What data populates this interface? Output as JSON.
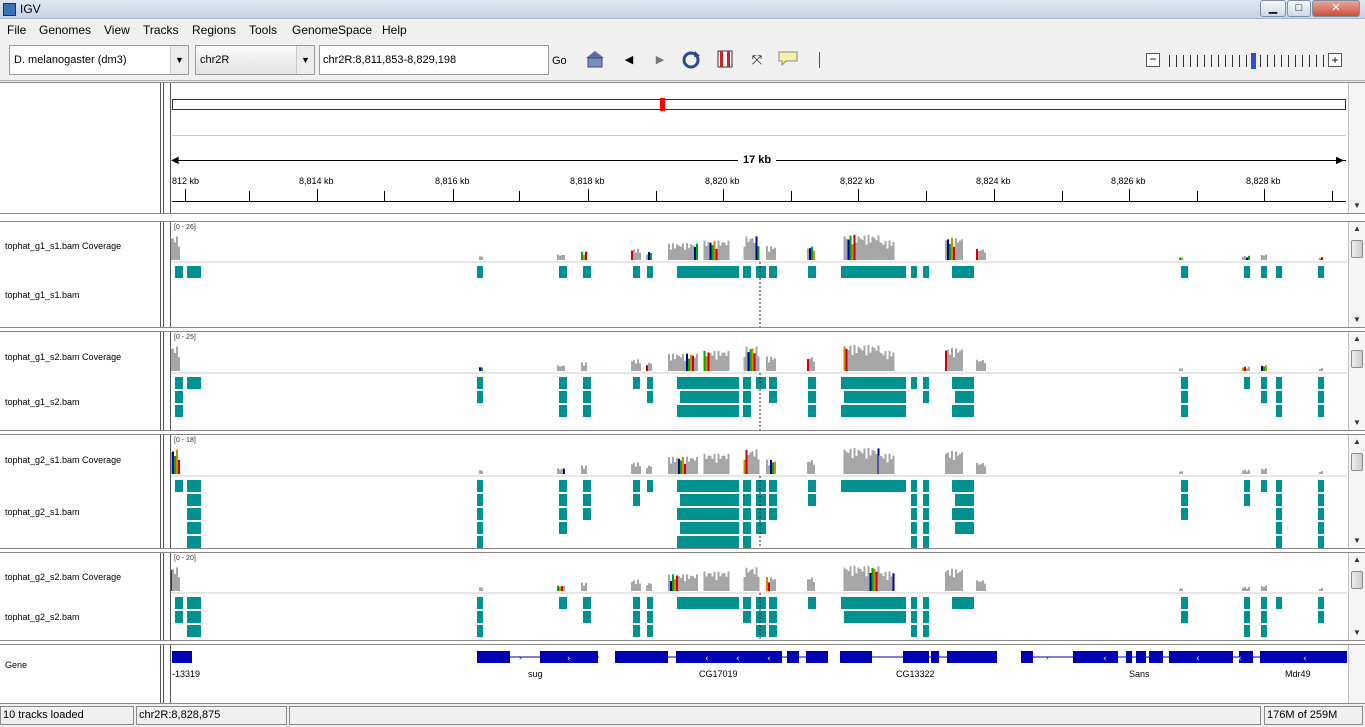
{
  "window": {
    "title": "IGV",
    "minimize": "▁",
    "maximize": "□",
    "close": "✕"
  },
  "menu": [
    "File",
    "Genomes",
    "View",
    "Tracks",
    "Regions",
    "Tools",
    "GenomeSpace",
    "Help"
  ],
  "toolbar": {
    "genome": "D. melanogaster (dm3)",
    "chromosome": "chr2R",
    "locus": "chr2R:8,811,853-8,829,198",
    "go_label": "Go",
    "zoom_minus": "−",
    "zoom_plus": "+",
    "zoom_level": 0.55
  },
  "ruler": {
    "span_label": "17 kb",
    "ticks": [
      "812 kb",
      "8,814 kb",
      "8,816 kb",
      "8,818 kb",
      "8,820 kb",
      "8,822 kb",
      "8,824 kb",
      "8,826 kb",
      "8,828 kb"
    ]
  },
  "tracks": [
    {
      "coverage": "tophat_g1_s1.bam Coverage",
      "alignment": "tophat_g1_s1.bam",
      "range": "[0 - 26]"
    },
    {
      "coverage": "tophat_g1_s2.bam Coverage",
      "alignment": "tophat_g1_s2.bam",
      "range": "[0 - 25]"
    },
    {
      "coverage": "tophat_g2_s1.bam Coverage",
      "alignment": "tophat_g2_s1.bam",
      "range": "[0 - 18]"
    },
    {
      "coverage": "tophat_g2_s2.bam Coverage",
      "alignment": "tophat_g2_s2.bam",
      "range": "[0 - 20]"
    }
  ],
  "gene_track": {
    "label": "Gene",
    "genes": [
      "-13319",
      "sug",
      "CG17019",
      "CG13322",
      "Sans",
      "Mdr49"
    ]
  },
  "status": {
    "tracks_loaded": "10 tracks loaded",
    "position": "chr2R:8,828,875",
    "memory": "176M of 259M"
  },
  "colors": {
    "read": "#009191",
    "coverage": "#a6a6a6",
    "gene": "#0000b2",
    "cytoband_marker": "#ff0000"
  }
}
